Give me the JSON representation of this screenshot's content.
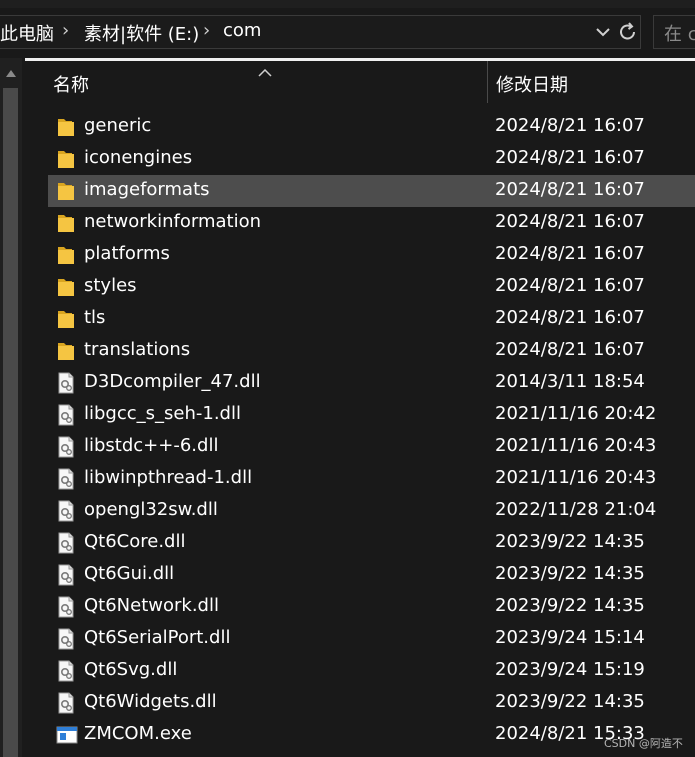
{
  "address": {
    "crumbs": [
      "此电脑",
      "素材|软件 (E:)",
      "com"
    ],
    "search_placeholder": "在 c"
  },
  "columns": {
    "name": "名称",
    "date_modified": "修改日期"
  },
  "files": [
    {
      "name": "generic",
      "date": "2024/8/21 16:07",
      "type": "folder",
      "selected": false
    },
    {
      "name": "iconengines",
      "date": "2024/8/21 16:07",
      "type": "folder",
      "selected": false
    },
    {
      "name": "imageformats",
      "date": "2024/8/21 16:07",
      "type": "folder",
      "selected": true
    },
    {
      "name": "networkinformation",
      "date": "2024/8/21 16:07",
      "type": "folder",
      "selected": false
    },
    {
      "name": "platforms",
      "date": "2024/8/21 16:07",
      "type": "folder",
      "selected": false
    },
    {
      "name": "styles",
      "date": "2024/8/21 16:07",
      "type": "folder",
      "selected": false
    },
    {
      "name": "tls",
      "date": "2024/8/21 16:07",
      "type": "folder",
      "selected": false
    },
    {
      "name": "translations",
      "date": "2024/8/21 16:07",
      "type": "folder",
      "selected": false
    },
    {
      "name": "D3Dcompiler_47.dll",
      "date": "2014/3/11 18:54",
      "type": "dll",
      "selected": false
    },
    {
      "name": "libgcc_s_seh-1.dll",
      "date": "2021/11/16 20:42",
      "type": "dll",
      "selected": false
    },
    {
      "name": "libstdc++-6.dll",
      "date": "2021/11/16 20:43",
      "type": "dll",
      "selected": false
    },
    {
      "name": "libwinpthread-1.dll",
      "date": "2021/11/16 20:43",
      "type": "dll",
      "selected": false
    },
    {
      "name": "opengl32sw.dll",
      "date": "2022/11/28 21:04",
      "type": "dll",
      "selected": false
    },
    {
      "name": "Qt6Core.dll",
      "date": "2023/9/22 14:35",
      "type": "dll",
      "selected": false
    },
    {
      "name": "Qt6Gui.dll",
      "date": "2023/9/22 14:35",
      "type": "dll",
      "selected": false
    },
    {
      "name": "Qt6Network.dll",
      "date": "2023/9/22 14:35",
      "type": "dll",
      "selected": false
    },
    {
      "name": "Qt6SerialPort.dll",
      "date": "2023/9/24 15:14",
      "type": "dll",
      "selected": false
    },
    {
      "name": "Qt6Svg.dll",
      "date": "2023/9/24 15:19",
      "type": "dll",
      "selected": false
    },
    {
      "name": "Qt6Widgets.dll",
      "date": "2023/9/22 14:35",
      "type": "dll",
      "selected": false
    },
    {
      "name": "ZMCOM.exe",
      "date": "2024/8/21 15:33",
      "type": "exe",
      "selected": false
    }
  ],
  "watermark": "CSDN @阿造不",
  "colors": {
    "folder": "#f5c542",
    "selected_row": "#4d4d4d",
    "background": "#191919"
  }
}
